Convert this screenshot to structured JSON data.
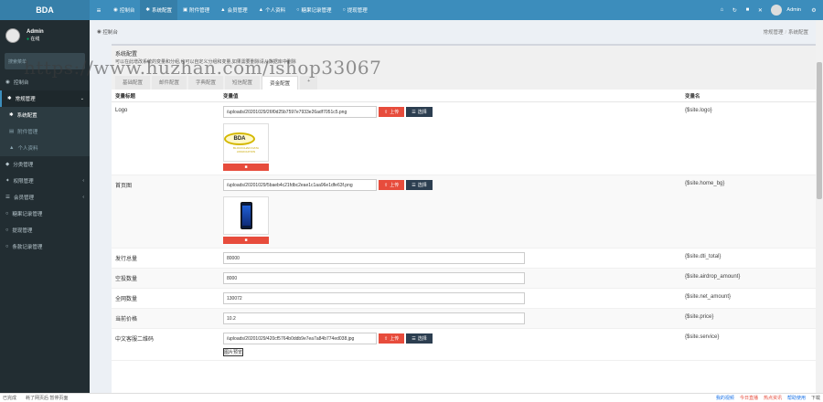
{
  "brand": "BDA",
  "topnav": [
    {
      "icon": "dashboard-icon",
      "label": "控制台"
    },
    {
      "icon": "gear-icon",
      "label": "系统配置",
      "active": true
    },
    {
      "icon": "doc-icon",
      "label": "附件管理"
    },
    {
      "icon": "user-icon",
      "label": "会员管理"
    },
    {
      "icon": "user-icon",
      "label": "个人资料"
    },
    {
      "icon": "circle-icon",
      "label": "糖果记录管理"
    },
    {
      "icon": "circle-icon",
      "label": "提现管理"
    }
  ],
  "topright": {
    "user": "Admin"
  },
  "sidebar": {
    "user_name": "Admin",
    "user_status": "在线",
    "search_placeholder": "搜索菜单",
    "items": [
      {
        "label": "控制台"
      },
      {
        "label": "常规管理",
        "header": true
      },
      {
        "label": "系统配置",
        "sub": true,
        "active": true
      },
      {
        "label": "附件管理",
        "sub": true
      },
      {
        "label": "个人资料",
        "sub": true
      },
      {
        "label": "分类管理"
      },
      {
        "label": "权限管理"
      },
      {
        "label": "会员管理"
      },
      {
        "label": "糖果记录管理"
      },
      {
        "label": "提现管理"
      },
      {
        "label": "条款记录管理"
      }
    ]
  },
  "breadcrumb": {
    "left": "控制台",
    "crumbs": [
      "常规管理",
      "系统配置"
    ]
  },
  "panel": {
    "title": "系统配置",
    "desc": "可以在此增改系统的变量和分组,也可以自定义分组和变量,如果需要删除请从数据库中删除",
    "tabs": [
      "基础配置",
      "邮件配置",
      "字典配置",
      "短信配置",
      "资金配置",
      "+"
    ]
  },
  "table": {
    "headers": [
      "变量标题",
      "变量值",
      "变量名"
    ],
    "rows": [
      {
        "title": "Logo",
        "value": "/uploads/20201029/26f0d25b7597e7933e26adf7051c5.png",
        "var": "{$site.logo}",
        "kind": "image",
        "img": "logo",
        "btn_upload": "上传",
        "btn_choose": "选择",
        "logo_text": "BDA",
        "logo_sub": "BLOCKCHAIN DATA ASSOCIATION"
      },
      {
        "title": "首页图",
        "value": "/uploads/20201029/5baeb4c21fdbc2eae1c1aa96e1dfe63f.png",
        "var": "{$site.home_bg}",
        "kind": "image",
        "img": "phone",
        "btn_upload": "上传",
        "btn_choose": "选择"
      },
      {
        "title": "发行总量",
        "value": "80000",
        "var": "{$site.dti_total}",
        "kind": "text"
      },
      {
        "title": "空投数量",
        "value": "8000",
        "var": "{$site.airdrop_amount}",
        "kind": "text"
      },
      {
        "title": "全网数量",
        "value": "130072",
        "var": "{$site.net_amount}",
        "kind": "text"
      },
      {
        "title": "当前价格",
        "value": "10.2",
        "var": "{$site.price}",
        "kind": "text"
      },
      {
        "title": "中文客服二维码",
        "value": "/uploads/20201029/420cf5764b0ddb9e7ea7a84b774ed038.jpg",
        "var": "{$site.service}",
        "kind": "image",
        "img": "qr",
        "btn_upload": "上传",
        "btn_choose": "选择",
        "qr_text": "图片预览"
      }
    ]
  },
  "watermark": "https://www.huzhan.com/ishop33067",
  "statusbar": {
    "left": "已完成",
    "left2": "耗了网页后 暂停页面",
    "right": [
      "我的视频",
      "今日直播",
      "热点资讯",
      "帮助使用",
      "下载"
    ]
  },
  "colors": {
    "topbar": "#3c8dbc",
    "sidebar": "#222d32",
    "danger": "#e74c3c",
    "dark": "#2c3e50"
  }
}
